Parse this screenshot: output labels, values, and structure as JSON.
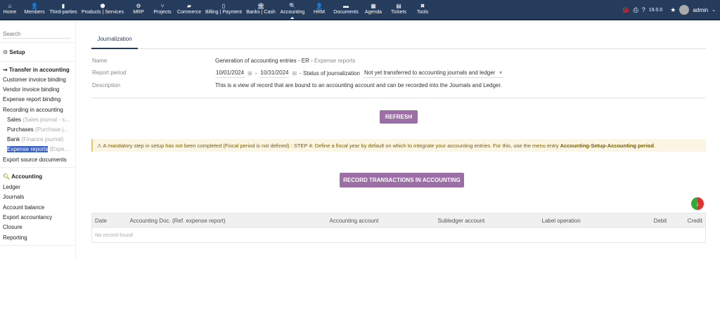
{
  "topnav": [
    {
      "label": "Home",
      "icon": "⌂"
    },
    {
      "label": "Members",
      "icon": "👤"
    },
    {
      "label": "Third-parties",
      "icon": "▮"
    },
    {
      "label": "Products | Services",
      "icon": "⬢"
    },
    {
      "label": "MRP",
      "icon": "⚙"
    },
    {
      "label": "Projects",
      "icon": "⑂"
    },
    {
      "label": "Commerce",
      "icon": "▰"
    },
    {
      "label": "Billing | Payment",
      "icon": "▯"
    },
    {
      "label": "Banks | Cash",
      "icon": "🏛"
    },
    {
      "label": "Accounting",
      "icon": "🔍"
    },
    {
      "label": "HRM",
      "icon": "👤"
    },
    {
      "label": "Documents",
      "icon": "▬"
    },
    {
      "label": "Agenda",
      "icon": "▦"
    },
    {
      "label": "Tickets",
      "icon": "▤"
    },
    {
      "label": "Tools",
      "icon": "✖"
    }
  ],
  "topright": {
    "version": "19.0.0",
    "user": "admin"
  },
  "sidebar": {
    "search_placeholder": "Search",
    "setup": "Setup",
    "transfer": "Transfer in accounting",
    "items": [
      "Customer invoice binding",
      "Vendor invoice binding",
      "Expense report binding",
      "Recording in accounting"
    ],
    "journals": [
      {
        "label": "Sales",
        "hint": "(Sales journal - s..."
      },
      {
        "label": "Purchases",
        "hint": "(Purchase j..."
      },
      {
        "label": "Bank",
        "hint": "(Finance journal)"
      },
      {
        "label": "Expense reports",
        "hint": "(Expe..."
      }
    ],
    "export_source": "Export source documents",
    "accounting": "Accounting",
    "acc_items": [
      "Ledger",
      "Journals",
      "Account balance",
      "Export accountancy",
      "Closure",
      "Reporting"
    ]
  },
  "main": {
    "tab": "Journalization",
    "name_label": "Name",
    "name_value": "Generation of accounting entries - ER -",
    "name_hint": "Expense reports",
    "period_label": "Report period",
    "date_from": "10/01/2024",
    "date_to": "10/31/2024",
    "status_label": "- Status of journalization",
    "status_value": "Not yet transferred to accounting journals and ledger",
    "desc_label": "Description",
    "desc_value": "This is a view of record that are bound to an accounting account and can be recorded into the Journals and Ledger.",
    "refresh": "REFRESH",
    "warning": "A mandatory step in setup has not been completed (Fiscal period is not defined) : STEP 4: Define a fiscal year by default on which to integrate your accounting entries. For this, use the menu entry",
    "warning_link": "Accounting-Setup-Accounting period",
    "record_btn": "RECORD TRANSACTIONS IN ACCOUNTING",
    "columns": [
      "Date",
      "Accounting Doc. (Ref. expense report)",
      "Accounting account",
      "Subledger account",
      "Label operation",
      "Debit",
      "Credit"
    ],
    "empty": "No record found"
  }
}
